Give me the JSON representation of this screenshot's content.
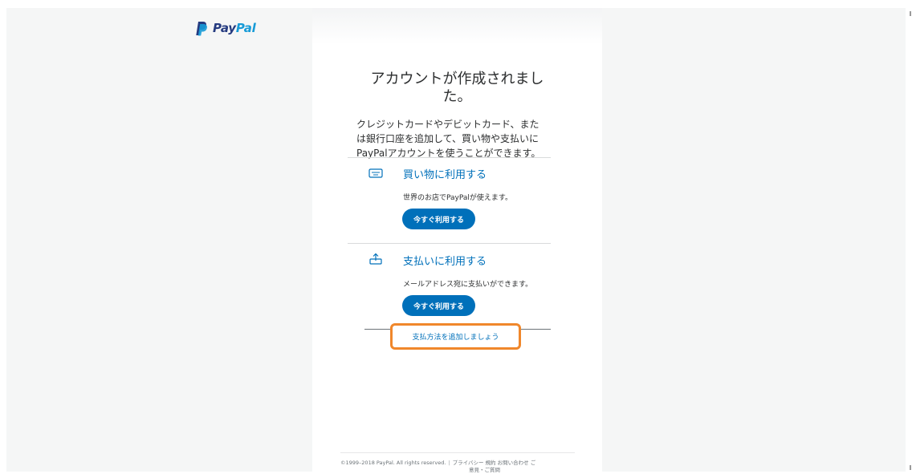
{
  "header": {
    "logo_pay": "Pay",
    "logo_pal": "Pal"
  },
  "main": {
    "title_line1": "アカウントが作成されまし",
    "title_line2": "た。",
    "description_lines": [
      "クレジットカードやデビットカード、また",
      "は銀行口座を追加して、買い物や支払いに",
      "PayPalアカウントを使うことができます。"
    ],
    "sections": [
      {
        "title": "買い物に利用する",
        "description": "世界のお店でPayPalが使えます。",
        "button_label": "今すぐ利用する",
        "icon": "paypal-card-icon"
      },
      {
        "title": "支払いに利用する",
        "description": "メールアドレス宛に支払いができます。",
        "button_label": "今すぐ利用する",
        "icon": "send-payment-icon"
      }
    ],
    "add_payment_link": "支払方法を追加しましょう"
  },
  "footer": {
    "copyright": "©1999–2018 PayPal. All rights reserved.",
    "separator": "|",
    "links": [
      "プライバシー",
      "規約",
      "お問い合わせ",
      "ご"
    ],
    "overflow_line": "意見・ご質問"
  },
  "colors": {
    "brand_blue": "#0070ba",
    "paypal_navy": "#253b80",
    "paypal_light": "#179bd7",
    "highlight_orange": "#f0872b"
  }
}
